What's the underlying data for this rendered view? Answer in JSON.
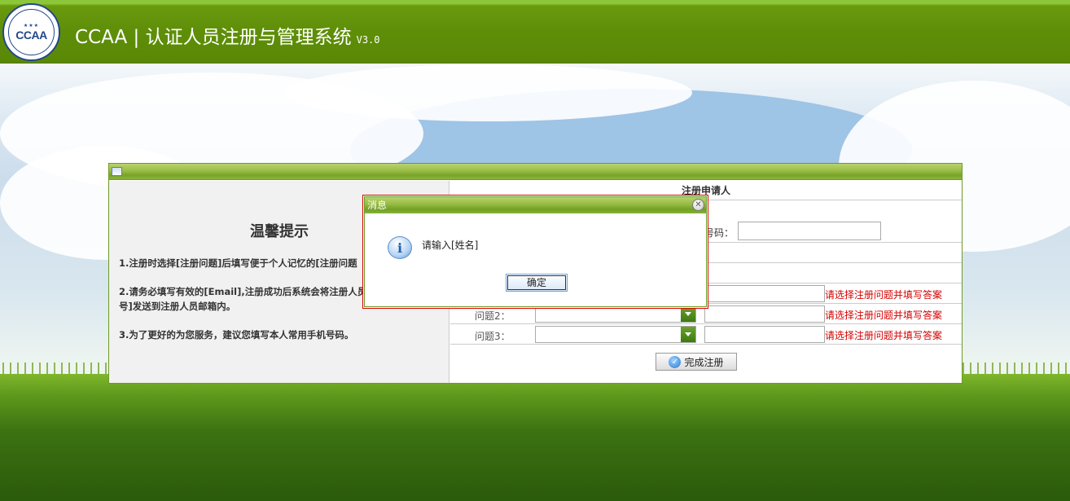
{
  "header": {
    "logo_text": "CCAA",
    "title": "CCAA | 认证人员注册与管理系统",
    "version": "V3.0"
  },
  "tips": {
    "title": "温馨提示",
    "items": [
      "1.注册时选择[注册问题]后填写便于个人记忆的[注册问题",
      "2.请务必填写有效的[Email],注册成功后系统会将注册人员",
      "号]发送到注册人员邮箱内。",
      "3.为了更好的为您服务，建议您填写本人常用手机号码。"
    ]
  },
  "form": {
    "header": "注册申请人",
    "phone_label": "号码：",
    "questions": [
      {
        "label": "",
        "hint": "请选择注册问题并填写答案"
      },
      {
        "label": "问题2：",
        "hint": "请选择注册问题并填写答案"
      },
      {
        "label": "问题3：",
        "hint": "请选择注册问题并填写答案"
      }
    ],
    "submit_label": "完成注册"
  },
  "dialog": {
    "title": "消息",
    "message": "请输入[姓名]",
    "ok_label": "确定",
    "close_glyph": "✕",
    "info_glyph": "i"
  },
  "colors": {
    "header_green": "#5e8e08",
    "hint_red": "#d40000",
    "dialog_border": "#e00000"
  }
}
